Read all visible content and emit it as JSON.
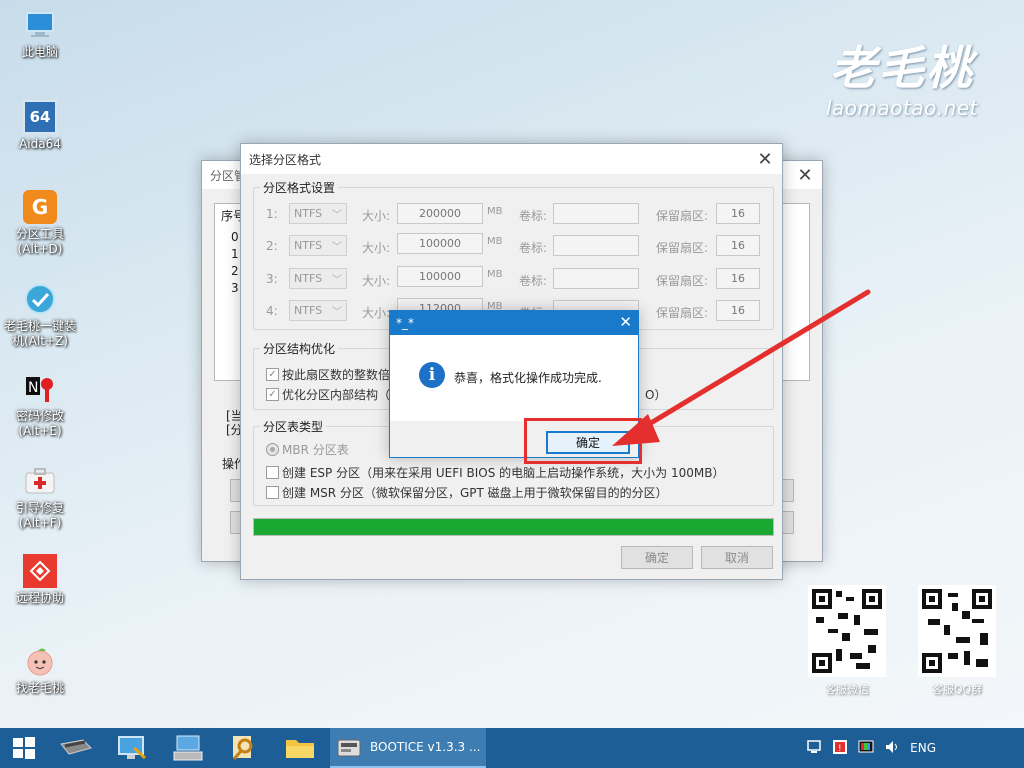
{
  "desktop": {
    "icons": [
      {
        "label": "此电脑"
      },
      {
        "label": "Aida64",
        "badge": "64"
      },
      {
        "label": "分区工具",
        "sub": "(Alt+D)"
      },
      {
        "label": "老毛桃一键装",
        "sub": "机(Alt+Z)"
      },
      {
        "label": "密码修改",
        "sub": "(Alt+E)"
      },
      {
        "label": "引导修复",
        "sub": "(Alt+F)"
      },
      {
        "label": "远程协助"
      },
      {
        "label": "找老毛桃"
      }
    ]
  },
  "brand": {
    "name": "老毛桃",
    "url": "laomaotao.net"
  },
  "qr": {
    "wechat_label": "客服微信",
    "qq_label": "客服QQ群"
  },
  "back_window": {
    "title": "分区管",
    "col_header": "序号",
    "rows": [
      "0",
      "1",
      "2",
      "3"
    ],
    "info_lines": [
      "[当",
      "[分"
    ],
    "ops_label": "操作"
  },
  "format_dialog": {
    "title": "选择分区格式",
    "settings_group": "分区格式设置",
    "partitions": [
      {
        "idx": "1:",
        "fs": "NTFS",
        "size": "200000",
        "unit": "MB",
        "reserved": "16"
      },
      {
        "idx": "2:",
        "fs": "NTFS",
        "size": "100000",
        "unit": "MB",
        "reserved": "16"
      },
      {
        "idx": "3:",
        "fs": "NTFS",
        "size": "100000",
        "unit": "MB",
        "reserved": "16"
      },
      {
        "idx": "4:",
        "fs": "NTFS",
        "size": "112000",
        "unit": "MB",
        "reserved": "16"
      }
    ],
    "size_label": "大小:",
    "volume_label": "卷标:",
    "reserved_label": "保留扇区:",
    "opt_group": "分区结构优化",
    "opt1": "按此扇区数的整数倍",
    "opt2": "优化分区内部结构（",
    "opt2_tail": "O）",
    "table_group": "分区表类型",
    "mbr": "MBR 分区表",
    "esp": "创建 ESP 分区（用来在采用 UEFI BIOS 的电脑上启动操作系统，大小为 100MB）",
    "msr": "创建 MSR 分区（微软保留分区，GPT 磁盘上用于微软保留目的的分区）",
    "progress": 1.0,
    "ok": "确定",
    "cancel": "取消"
  },
  "message_box": {
    "title": "*_*",
    "message": "恭喜，格式化操作成功完成.",
    "ok": "确定"
  },
  "taskbar": {
    "app_label": "BOOTICE v1.3.3 ...",
    "lang": "ENG"
  },
  "colors": {
    "progress": "#1aa832",
    "accent": "#0a6cc4",
    "highlight": "#e52e2e"
  }
}
